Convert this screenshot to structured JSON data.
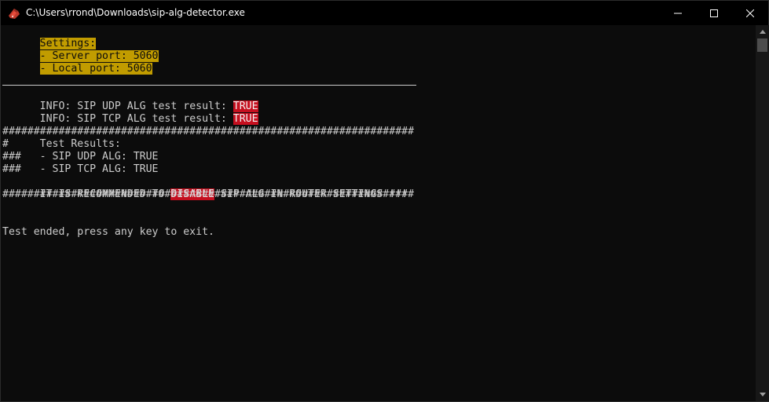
{
  "window": {
    "title": "C:\\Users\\rrond\\Downloads\\sip-alg-detector.exe",
    "icon": "console-app-icon"
  },
  "console": {
    "settings_header": "Settings:",
    "server_port": "- Server port: 5060",
    "local_port": "- Local port: 5060",
    "info_udp_prefix": "INFO: SIP UDP ALG test result: ",
    "info_udp_value": "TRUE",
    "info_tcp_prefix": "INFO: SIP TCP ALG test result: ",
    "info_tcp_value": "TRUE",
    "hash_border": "##################################################################",
    "results_header": "#     Test Results:",
    "results_udp": "###   - SIP UDP ALG: TRUE",
    "results_tcp": "###   - SIP TCP ALG: TRUE",
    "recommend_prefix": "IT IS RECOMMENDED TO ",
    "recommend_highlight": "DISABLE",
    "recommend_suffix": " SIP ALG IN ROUTER SETTINGS !!!",
    "exit_message": "Test ended, press any key to exit."
  },
  "colors": {
    "background": "#0c0c0c",
    "text": "#cccccc",
    "highlight_yellow": "#c19c00",
    "highlight_red": "#c50f1f"
  }
}
